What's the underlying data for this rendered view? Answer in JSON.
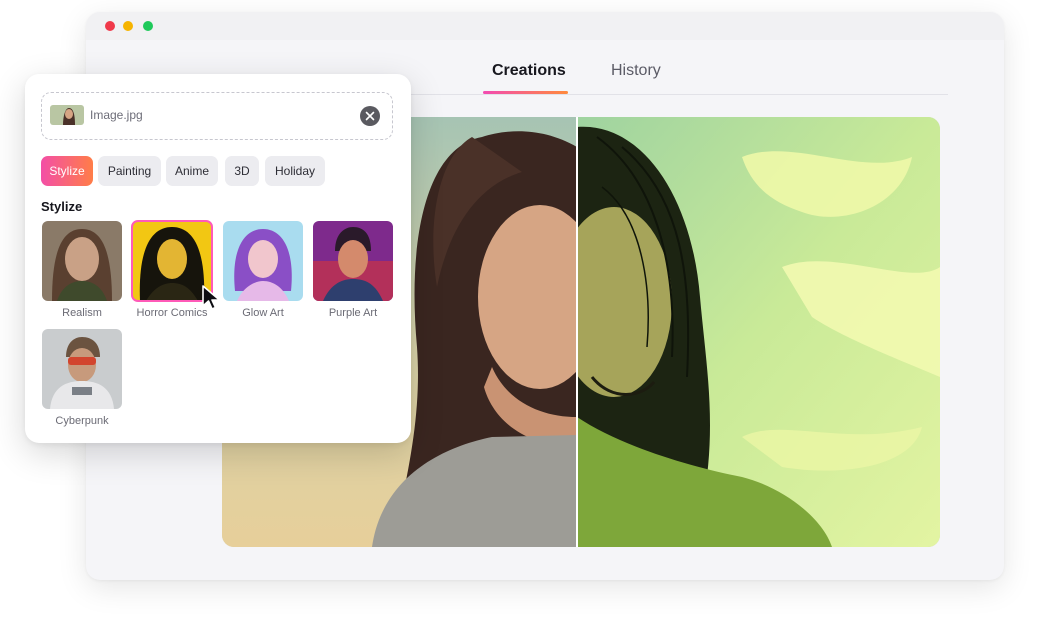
{
  "window": {
    "controls": [
      "close",
      "minimize",
      "maximize"
    ]
  },
  "tabs": [
    {
      "label": "Creations",
      "active": true
    },
    {
      "label": "History",
      "active": false
    }
  ],
  "panel": {
    "upload": {
      "filename": "Image.jpg",
      "thumb_icon": "photo-thumbnail",
      "clear_icon": "close-icon"
    },
    "chips": [
      {
        "label": "Stylize",
        "active": true
      },
      {
        "label": "Painting",
        "active": false
      },
      {
        "label": "Anime",
        "active": false
      },
      {
        "label": "3D",
        "active": false
      },
      {
        "label": "Holiday",
        "active": false
      }
    ],
    "section_title": "Stylize",
    "styles": [
      {
        "label": "Realism",
        "selected": false
      },
      {
        "label": "Horror Comics",
        "selected": true
      },
      {
        "label": "Glow Art",
        "selected": false
      },
      {
        "label": "Purple Art",
        "selected": false
      },
      {
        "label": "Cyberpunk",
        "selected": false
      }
    ]
  },
  "colors": {
    "accent_start": "#f34fa6",
    "accent_end": "#ff7d48",
    "window_bg": "#f5f5f8"
  }
}
